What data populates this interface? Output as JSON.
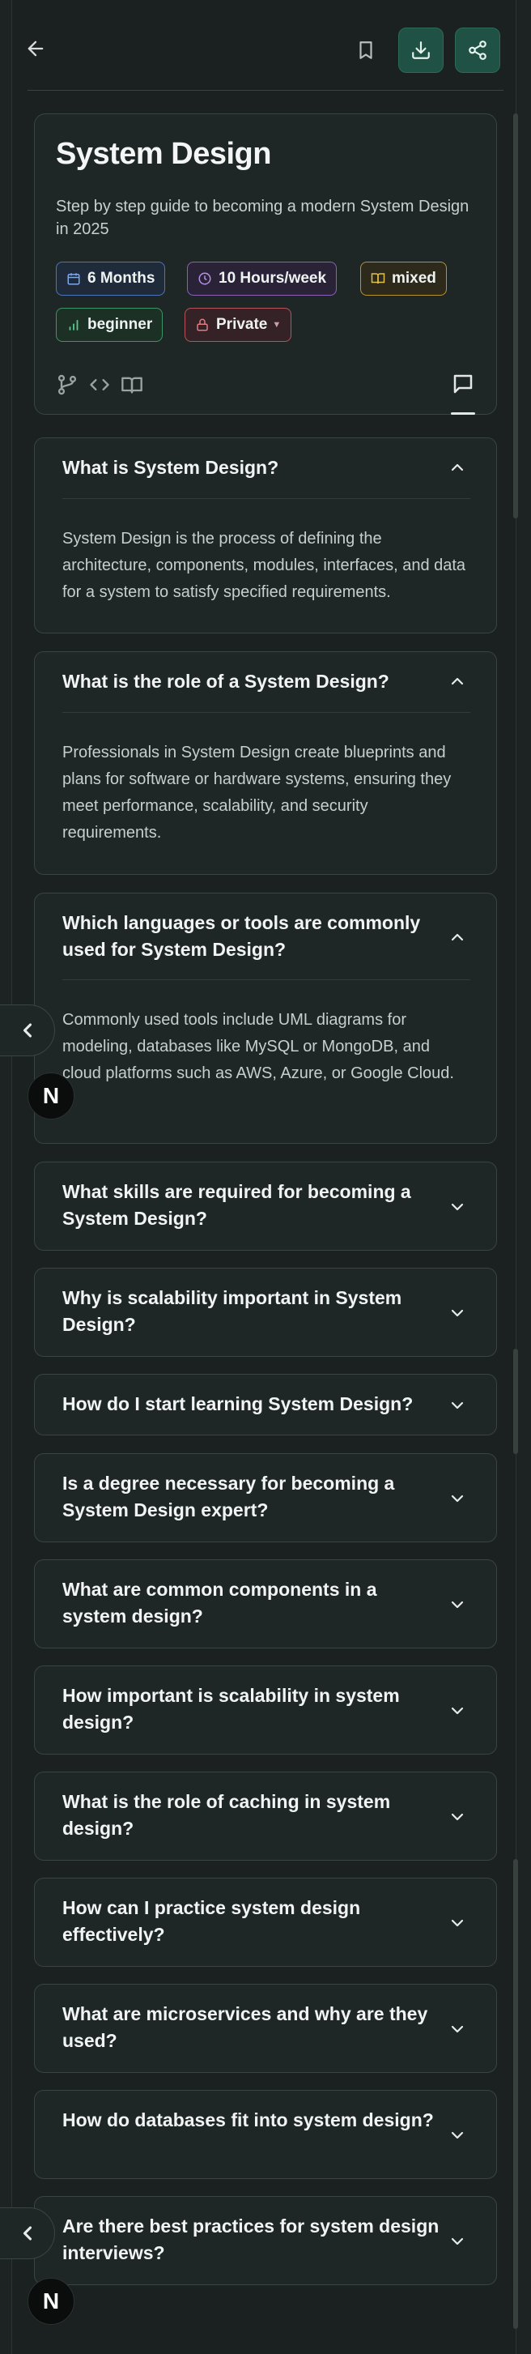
{
  "header": {
    "back_icon": "arrow-left-icon",
    "bookmark_icon": "bookmark-icon",
    "download_icon": "download-icon",
    "share_icon": "share-icon"
  },
  "roadmap": {
    "title": "System Design",
    "description": "Step by step guide to becoming a modern System Design in 2025",
    "tags": {
      "duration": "6 Months",
      "hours": "10 Hours/week",
      "mode": "mixed",
      "level": "beginner",
      "visibility": "Private"
    }
  },
  "faqs": [
    {
      "question": "What is System Design?",
      "answer": "System Design is the process of defining the architecture, components, modules, interfaces, and data for a system to satisfy specified requirements.",
      "expanded": true
    },
    {
      "question": "What is the role of a System Design?",
      "answer": "Professionals in System Design create blueprints and plans for software or hardware systems, ensuring they meet performance, scalability, and security requirements.",
      "expanded": true
    },
    {
      "question": "Which languages or tools are commonly used for System Design?",
      "answer": "Commonly used tools include UML diagrams for modeling, databases like MySQL or MongoDB, and cloud platforms such as AWS, Azure, or Google Cloud.",
      "expanded": true
    },
    {
      "question": "What skills are required for becoming a System Design?",
      "expanded": false
    },
    {
      "question": "Why is scalability important in System Design?",
      "expanded": false
    },
    {
      "question": "How do I start learning System Design?",
      "expanded": false
    },
    {
      "question": "Is a degree necessary for becoming a System Design expert?",
      "expanded": false
    },
    {
      "question": "What are common components in a system design?",
      "expanded": false
    },
    {
      "question": "How important is scalability in system design?",
      "expanded": false
    },
    {
      "question": "What is the role of caching in system design?",
      "expanded": false
    },
    {
      "question": "How can I practice system design effectively?",
      "expanded": false
    },
    {
      "question": "What are microservices and why are they used?",
      "expanded": false
    },
    {
      "question": "How do databases fit into system design?",
      "expanded": false
    },
    {
      "question": "Are there best practices for system design interviews?",
      "expanded": false
    }
  ],
  "overlay": {
    "badge_letter": "N"
  },
  "colors": {
    "accent": "#1f5244",
    "background": "#1a2120",
    "card": "#1f2726"
  }
}
